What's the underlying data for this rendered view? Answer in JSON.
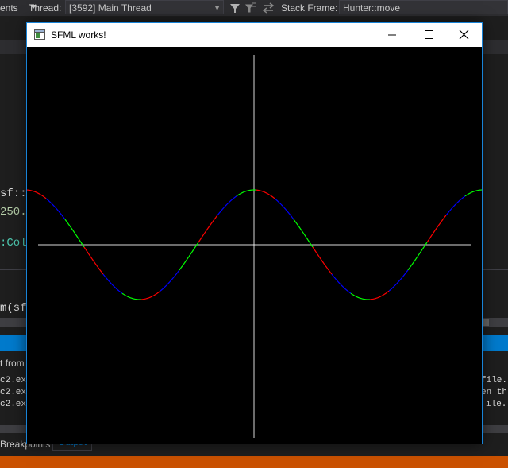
{
  "toolbar": {
    "events_label": "ents",
    "thread_label": "Thread:",
    "thread_value": "[3592] Main Thread",
    "stack_frame_label": "Stack Frame:",
    "stack_frame_value": "Hunter::move"
  },
  "editor": {
    "line1": "sf::V",
    "line2": "250.",
    "line3": ":Colo",
    "line4": "m(sf"
  },
  "output": {
    "title": "t from",
    "lines_left": [
      "c2.ex",
      "c2.ex",
      "c2.ex"
    ],
    "lines_right": [
      "file.",
      "en th",
      "ile."
    ]
  },
  "bottom_tabs": {
    "breakpoints": "Breakpoints",
    "output": "Output"
  },
  "window": {
    "title": "SFML works!",
    "minimize_icon": "minimize-icon",
    "maximize_icon": "maximize-icon",
    "close_icon": "close-icon"
  },
  "colors": {
    "vs_background": "#1e1e1e",
    "vs_accent": "#007acc",
    "status_bar": "#ca5100",
    "window_border": "#1883d7",
    "curve_colors": [
      "#ff0000",
      "#0000ff",
      "#00ff00"
    ]
  },
  "chart_data": {
    "type": "line",
    "description_note": "",
    "curve": "cosine",
    "amplitude_units": 1,
    "periods_visible": 2,
    "peaks_at_origin": true,
    "axes_color": "#ffffff"
  }
}
